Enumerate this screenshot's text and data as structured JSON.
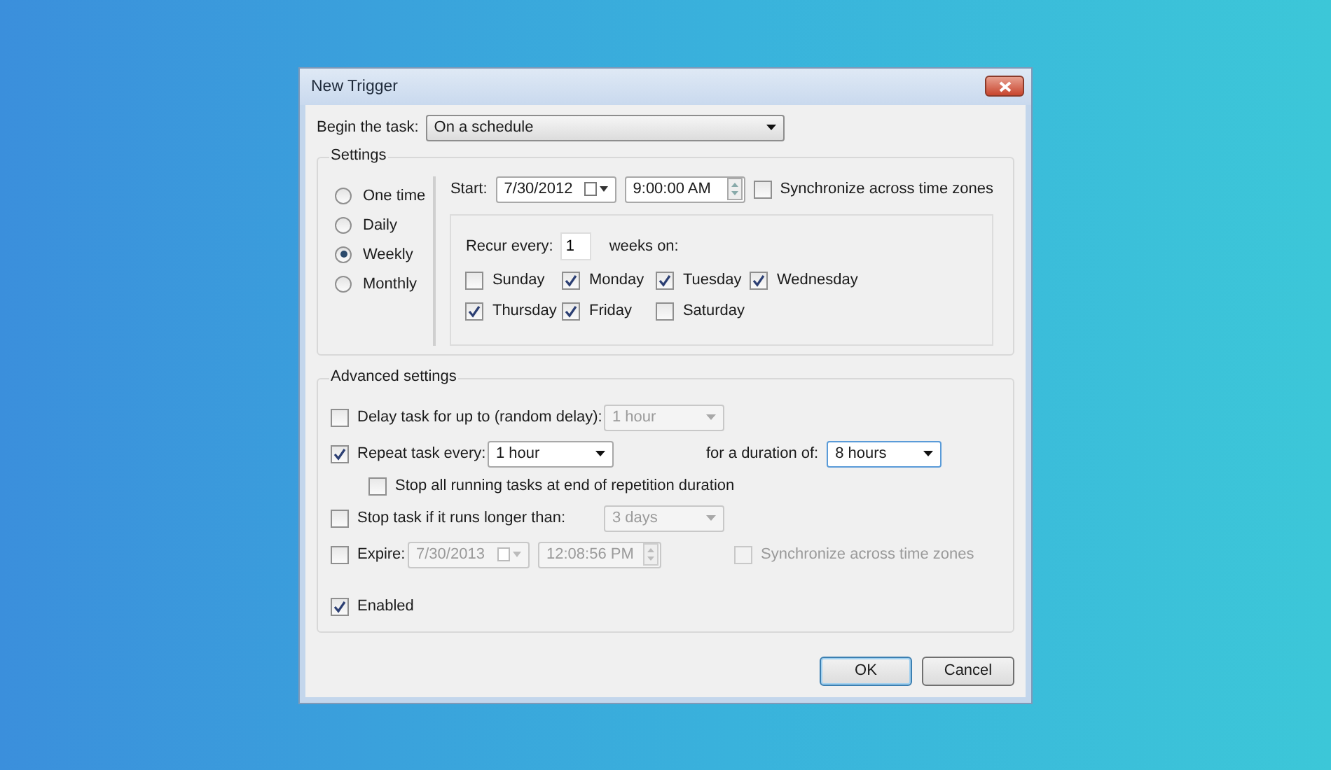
{
  "window": {
    "title": "New Trigger"
  },
  "begin": {
    "label": "Begin the task:",
    "value": "On a schedule"
  },
  "settings": {
    "title": "Settings",
    "schedules": [
      {
        "label": "One time",
        "selected": false
      },
      {
        "label": "Daily",
        "selected": false
      },
      {
        "label": "Weekly",
        "selected": true
      },
      {
        "label": "Monthly",
        "selected": false
      }
    ],
    "start": {
      "label": "Start:",
      "date": "7/30/2012",
      "time": "9:00:00 AM",
      "sync": {
        "label": "Synchronize across time zones",
        "checked": false
      }
    },
    "recur": {
      "label": "Recur every:",
      "value": "1",
      "suffix": "weeks on:"
    },
    "days": [
      {
        "label": "Sunday",
        "checked": false
      },
      {
        "label": "Monday",
        "checked": true
      },
      {
        "label": "Tuesday",
        "checked": true
      },
      {
        "label": "Wednesday",
        "checked": true
      },
      {
        "label": "Thursday",
        "checked": true
      },
      {
        "label": "Friday",
        "checked": true
      },
      {
        "label": "Saturday",
        "checked": false
      }
    ]
  },
  "advanced": {
    "title": "Advanced settings",
    "delay": {
      "label": "Delay task for up to (random delay):",
      "checked": false,
      "value": "1 hour"
    },
    "repeat": {
      "label": "Repeat task every:",
      "checked": true,
      "value": "1 hour",
      "duration_label": "for a duration of:",
      "duration": "8 hours"
    },
    "stop_all": {
      "label": "Stop all running tasks at end of repetition duration",
      "checked": false
    },
    "stop_long": {
      "label": "Stop task if it runs longer than:",
      "checked": false,
      "value": "3 days"
    },
    "expire": {
      "label": "Expire:",
      "checked": false,
      "date": "7/30/2013",
      "time": "12:08:56 PM",
      "sync": {
        "label": "Synchronize across time zones",
        "checked": false
      }
    },
    "enabled": {
      "label": "Enabled",
      "checked": true
    }
  },
  "buttons": [
    {
      "label": "OK",
      "default": true
    },
    {
      "label": "Cancel",
      "default": false
    }
  ]
}
